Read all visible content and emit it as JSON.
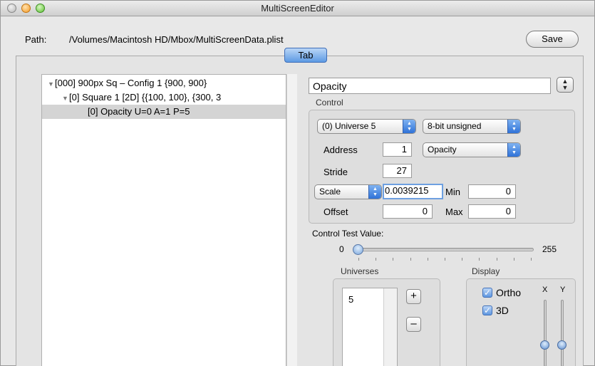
{
  "window": {
    "title": "MultiScreenEditor"
  },
  "path": {
    "label": "Path:",
    "value": "/Volumes/Macintosh HD/Mbox/MultiScreenData.plist"
  },
  "toolbar": {
    "save_label": "Save"
  },
  "tab": {
    "label": "Tab"
  },
  "tree": {
    "rows": [
      {
        "text": "[000] 900px Sq – Config 1 {900, 900}",
        "expanded": true
      },
      {
        "text": "[0] Square 1  [2D] {{100, 100}, {300, 3",
        "expanded": true
      },
      {
        "text": "[0] Opacity U=0 A=1 P=5",
        "selected": true
      }
    ]
  },
  "detail": {
    "name_value": "Opacity",
    "control": {
      "group_label": "Control",
      "universe_popup": "(0) Universe 5",
      "format_popup": "8-bit unsigned",
      "address_label": "Address",
      "address_value": "1",
      "attribute_popup": "Opacity",
      "stride_label": "Stride",
      "stride_value": "27",
      "scale_popup": "Scale",
      "scale_value": "0.0039215",
      "min_label": "Min",
      "min_value": "0",
      "offset_label": "Offset",
      "offset_value": "0",
      "max_label": "Max",
      "max_value": "0"
    },
    "test_value": {
      "label": "Control Test Value:",
      "min_label": "0",
      "max_label": "255",
      "value": 0
    },
    "universes": {
      "group_label": "Universes",
      "items": [
        "5"
      ],
      "add_label": "+",
      "remove_label": "–"
    },
    "display": {
      "group_label": "Display",
      "ortho_label": "Ortho",
      "ortho_checked": true,
      "three_d_label": "3D",
      "three_d_checked": true,
      "x_label": "X",
      "y_label": "Y"
    }
  },
  "colors": {
    "accent": "#5d9ae4",
    "selection": "#d4d4d4"
  }
}
